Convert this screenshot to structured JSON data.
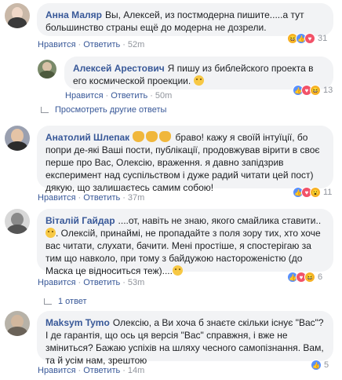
{
  "comments": [
    {
      "author": "Анна Маляр",
      "text": "Вы, Алексей, из постмодерна пишите.....а тут большинство страны ещё до модерна не дозрели.",
      "like": "Нравится",
      "reply": "Ответить",
      "time": "52m",
      "reactions_count": "31"
    },
    {
      "author": "Алексей Арестович",
      "text": "Я пишу из библейского проекта в его космической проекции.",
      "like": "Нравится",
      "reply": "Ответить",
      "time": "50m",
      "reactions_count": "13"
    },
    {
      "author": "Анатолий Шлепак",
      "text": "браво! кажу я своїй інтуїції, бо попри де-які Ваші пости, публікації, продовжував вірити в своє перше про Вас, Олексію, враження. я давно запідзрив експеримент над суспільством і дуже радий читати цей пост) дякую, що залишаєтесь самим собою!",
      "like": "Нравится",
      "reply": "Ответить",
      "time": "37m",
      "reactions_count": "11"
    },
    {
      "author": "Віталій Гайдар",
      "text_1": "....от, навіть не знаю, якого смайлика ставити..",
      "text_2": ". Олексій, принаймі, не пропадайте з поля зору тих, хто хоче вас читати, слухати, бачити. Мені простіше, я спостерігаю за тим що навколо, при тому з байдужою настороженістю (до Маска це відноситься теж)....",
      "like": "Нравится",
      "reply": "Ответить",
      "time": "53m",
      "reactions_count": "6"
    },
    {
      "author": "Maksym Tymo",
      "text": "Олексію, а Ви хоча б знаєте скільки існує \"Вас\"? І де гарантія, що ось ця версія \"Вас\" справжня, і вже не зміниться? Бажаю успіхів на шляху чесного самопізнання. Вам, та й усім нам, зрештою",
      "like": "Нравится",
      "reply": "Ответить",
      "time": "14m",
      "reactions_count": "5"
    }
  ],
  "more_replies": "Просмотреть другие ответы",
  "one_reply": "1 ответ",
  "dot": "·"
}
